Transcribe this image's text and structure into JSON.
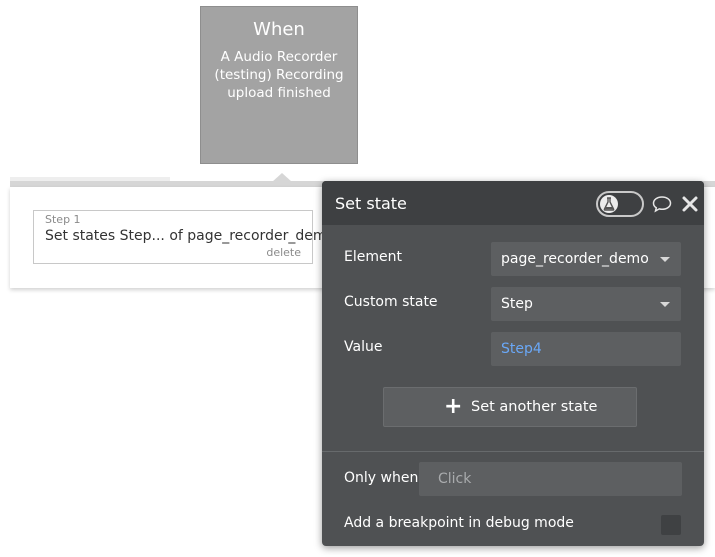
{
  "when": {
    "title": "When",
    "description": "A Audio Recorder (testing) Recording upload finished"
  },
  "step": {
    "number": "Step 1",
    "text": "Set states Step... of page_recorder_demo",
    "delete_label": "delete"
  },
  "panel": {
    "title": "Set state",
    "element_label": "Element",
    "element_value": "page_recorder_demo",
    "custom_state_label": "Custom state",
    "custom_state_value": "Step",
    "value_label": "Value",
    "value_value": "Step4",
    "add_button_label": "Set another state",
    "only_when_label": "Only when",
    "only_when_placeholder": "Click",
    "breakpoint_label": "Add a breakpoint in debug mode"
  },
  "icons": {
    "toggle": "flask-icon",
    "comment": "comment-icon",
    "close": "close-icon",
    "add": "plus-icon"
  },
  "colors": {
    "panel_bg": "#4f5153",
    "panel_header": "#3e4042",
    "field_bg": "#5d5f61",
    "link": "#6aa8f7",
    "when_bg": "#a3a3a3"
  }
}
